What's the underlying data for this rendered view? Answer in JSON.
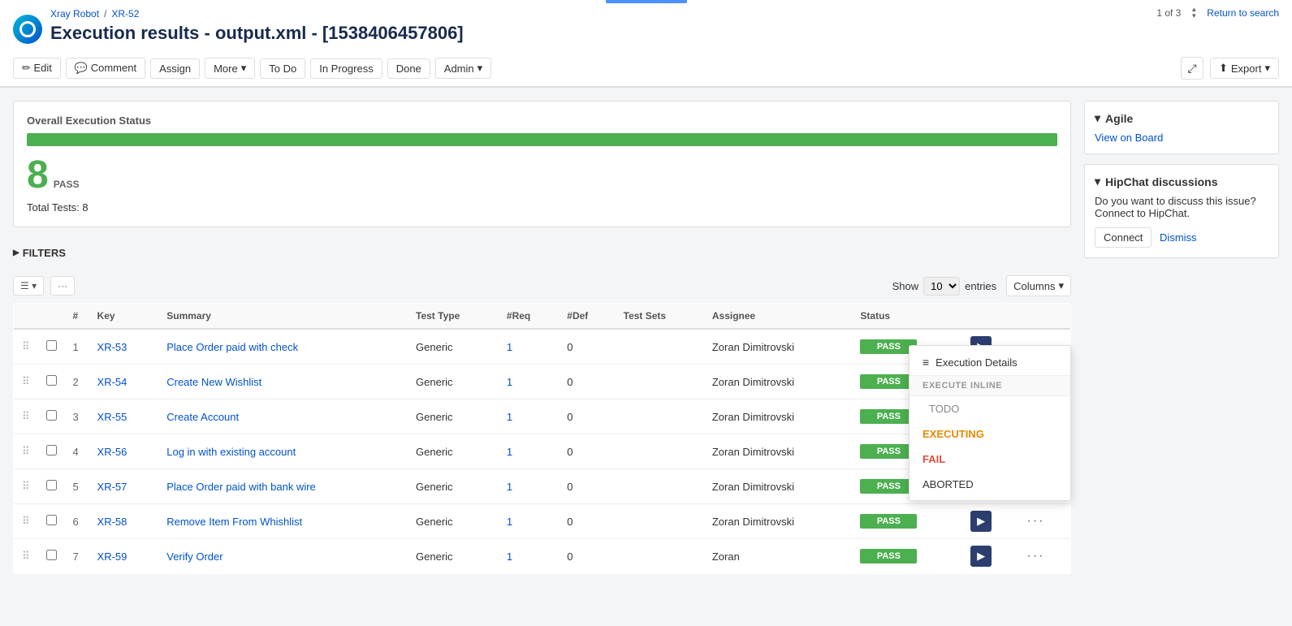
{
  "app": {
    "logo_alt": "Xray Robot logo"
  },
  "breadcrumb": {
    "parent": "Xray Robot",
    "separator": "/",
    "current": "XR-52"
  },
  "title": "Execution results - output.xml - [1538406457806]",
  "pagination": {
    "current": "1 of 3",
    "return_link": "Return to search"
  },
  "toolbar": {
    "edit": "✏ Edit",
    "comment": "💬 Comment",
    "assign": "Assign",
    "more": "More",
    "more_arrow": "▾",
    "todo": "To Do",
    "in_progress": "In Progress",
    "done": "Done",
    "admin": "Admin",
    "admin_arrow": "▾",
    "share_icon": "⤢",
    "export": "Export",
    "export_arrow": "▾"
  },
  "status": {
    "section_title": "Overall Execution Status",
    "pass_count": "8",
    "pass_label": "PASS",
    "progress_pct": 100,
    "total_tests_label": "Total Tests:",
    "total_tests_count": "8"
  },
  "filters": {
    "label": "FILTERS",
    "arrow": "▶"
  },
  "table_controls": {
    "show_label": "Show",
    "show_value": "10",
    "entries_label": "entries",
    "columns_label": "Columns",
    "columns_arrow": "▾"
  },
  "table": {
    "columns": [
      "Key",
      "Summary",
      "Test Type",
      "#Req",
      "#Def",
      "Test Sets",
      "Assignee",
      "Status"
    ],
    "rows": [
      {
        "num": "1",
        "key": "XR-53",
        "summary": "Place Order paid with check",
        "test_type": "Generic",
        "req": "1",
        "def": "0",
        "test_sets": "",
        "assignee": "Zoran Dimitrovski",
        "status": "PASS",
        "has_dropdown": true,
        "dropdown_open": true
      },
      {
        "num": "2",
        "key": "XR-54",
        "summary": "Create New Wishlist",
        "test_type": "Generic",
        "req": "1",
        "def": "0",
        "test_sets": "",
        "assignee": "Zoran Dimitrovski",
        "status": "PASS",
        "has_dropdown": false
      },
      {
        "num": "3",
        "key": "XR-55",
        "summary": "Create Account",
        "test_type": "Generic",
        "req": "1",
        "def": "0",
        "test_sets": "",
        "assignee": "Zoran Dimitrovski",
        "status": "PASS",
        "has_dropdown": false
      },
      {
        "num": "4",
        "key": "XR-56",
        "summary": "Log in with existing account",
        "test_type": "Generic",
        "req": "1",
        "def": "0",
        "test_sets": "",
        "assignee": "Zoran Dimitrovski",
        "status": "PASS",
        "has_dropdown": false
      },
      {
        "num": "5",
        "key": "XR-57",
        "summary": "Place Order paid with bank wire",
        "test_type": "Generic",
        "req": "1",
        "def": "0",
        "test_sets": "",
        "assignee": "Zoran Dimitrovski",
        "status": "PASS",
        "has_dropdown": false
      },
      {
        "num": "6",
        "key": "XR-58",
        "summary": "Remove Item From Whishlist",
        "test_type": "Generic",
        "req": "1",
        "def": "0",
        "test_sets": "",
        "assignee": "Zoran Dimitrovski",
        "status": "PASS",
        "has_dropdown": false
      },
      {
        "num": "7",
        "key": "XR-59",
        "summary": "Verify Order",
        "test_type": "Generic",
        "req": "1",
        "def": "0",
        "test_sets": "",
        "assignee": "Zoran",
        "status": "PASS",
        "has_dropdown": false
      }
    ]
  },
  "dropdown_menu": {
    "execution_details": "Execution Details",
    "execute_inline_label": "EXECUTE INLINE",
    "items": [
      {
        "label": "TODO",
        "class": "todo"
      },
      {
        "label": "EXECUTING",
        "class": "executing"
      },
      {
        "label": "FAIL",
        "class": "fail"
      },
      {
        "label": "ABORTED",
        "class": "aborted"
      }
    ]
  },
  "sidebar": {
    "agile": {
      "title": "Agile",
      "view_on_board": "View on Board"
    },
    "hipchat": {
      "title": "HipChat discussions",
      "text": "Do you want to discuss this issue? Connect to HipChat.",
      "connect_label": "Connect",
      "dismiss_label": "Dismiss"
    }
  }
}
